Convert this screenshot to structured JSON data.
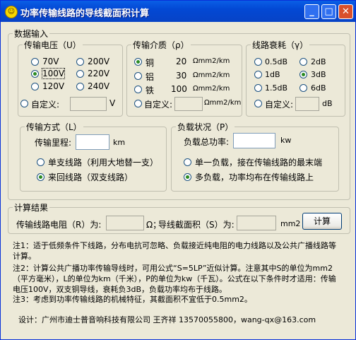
{
  "title": "功率传输线路的导线截面积计算",
  "data_input": {
    "legend": "数据输入",
    "voltage": {
      "legend": "传输电压（U）",
      "options": [
        "70V",
        "200V",
        "100V",
        "220V",
        "120V",
        "240V"
      ],
      "selected": "100V",
      "custom_label": "自定义:",
      "unit": "V"
    },
    "medium": {
      "legend": "传输介质（ρ）",
      "options": [
        {
          "name": "铜",
          "value": "20",
          "unit": "Ωmm2/km"
        },
        {
          "name": "铝",
          "value": "30",
          "unit": "Ωmm2/km"
        },
        {
          "name": "铁",
          "value": "100",
          "unit": "Ωmm2/km"
        }
      ],
      "selected": "铜",
      "custom_label": "自定义:",
      "custom_unit": "Ωmm2/km"
    },
    "attenuation": {
      "legend": "线路衰耗（γ）",
      "options": [
        "0.5dB",
        "2dB",
        "1dB",
        "3dB",
        "1.5dB",
        "6dB"
      ],
      "selected": "3dB",
      "custom_label": "自定义:",
      "unit": "dB"
    },
    "transmission": {
      "legend": "传输方式（L）",
      "mileage_label": "传输里程:",
      "mileage_unit": "km",
      "options": [
        "单支线路（利用大地替一支）",
        "来回线路（双支线路）"
      ],
      "selected": "来回线路（双支线路）"
    },
    "load": {
      "legend": "负载状况（P）",
      "power_label": "负载总功率:",
      "power_unit": "kw",
      "options": [
        "单一负载，接在传输线路的最末端",
        "多负载，功率均布在传输线路上"
      ],
      "selected": "多负载，功率均布在传输线路上"
    }
  },
  "result": {
    "legend": "计算结果",
    "resistance_label": "传输线路电阻（R）为:",
    "resistance_unit": "Ω；",
    "area_label": "导线截面积（S）为:",
    "area_unit": "mm2",
    "calc_button": "计算"
  },
  "notes": [
    "注1：适于低频条件下线路，分布电抗可忽略、负载接近纯电阻的电力线路以及公共广播线路等计算。",
    "注2：计算公共广播功率传输导线时，可用公式“S=5LP”近似计算。注意其中S的单位为mm2（平方毫米），L的单位为km（千米），P的单位为kw（千瓦）。公式在以下条件时才适用：传输电压100V，双支铜导线，衰耗负3dB，负载功率均布于线路。",
    "注3：考虑到功率传输线路的机械特征，其截面积不宜低于0.5mm2。"
  ],
  "designer": "设计：广州市迪士普音响科技有限公司 王齐祥 13570055800，wang-qx@163.com"
}
